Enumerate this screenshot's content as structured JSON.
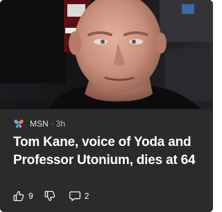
{
  "card": {
    "source": {
      "name": "MSN",
      "separator": "·",
      "age": "3h"
    },
    "headline": "Tom Kane, voice of Yoda and Professor Utonium, dies at 64",
    "actions": {
      "like_count": "9",
      "comment_count": "2"
    },
    "colors": {
      "card_background": "#2b2b2b",
      "text_primary": "#ffffff",
      "text_secondary": "#bdbdbd"
    },
    "icons": {
      "source": "msn-butterfly-icon",
      "like": "thumbs-up-icon",
      "dislike": "thumbs-down-icon",
      "comment": "comment-icon"
    }
  }
}
